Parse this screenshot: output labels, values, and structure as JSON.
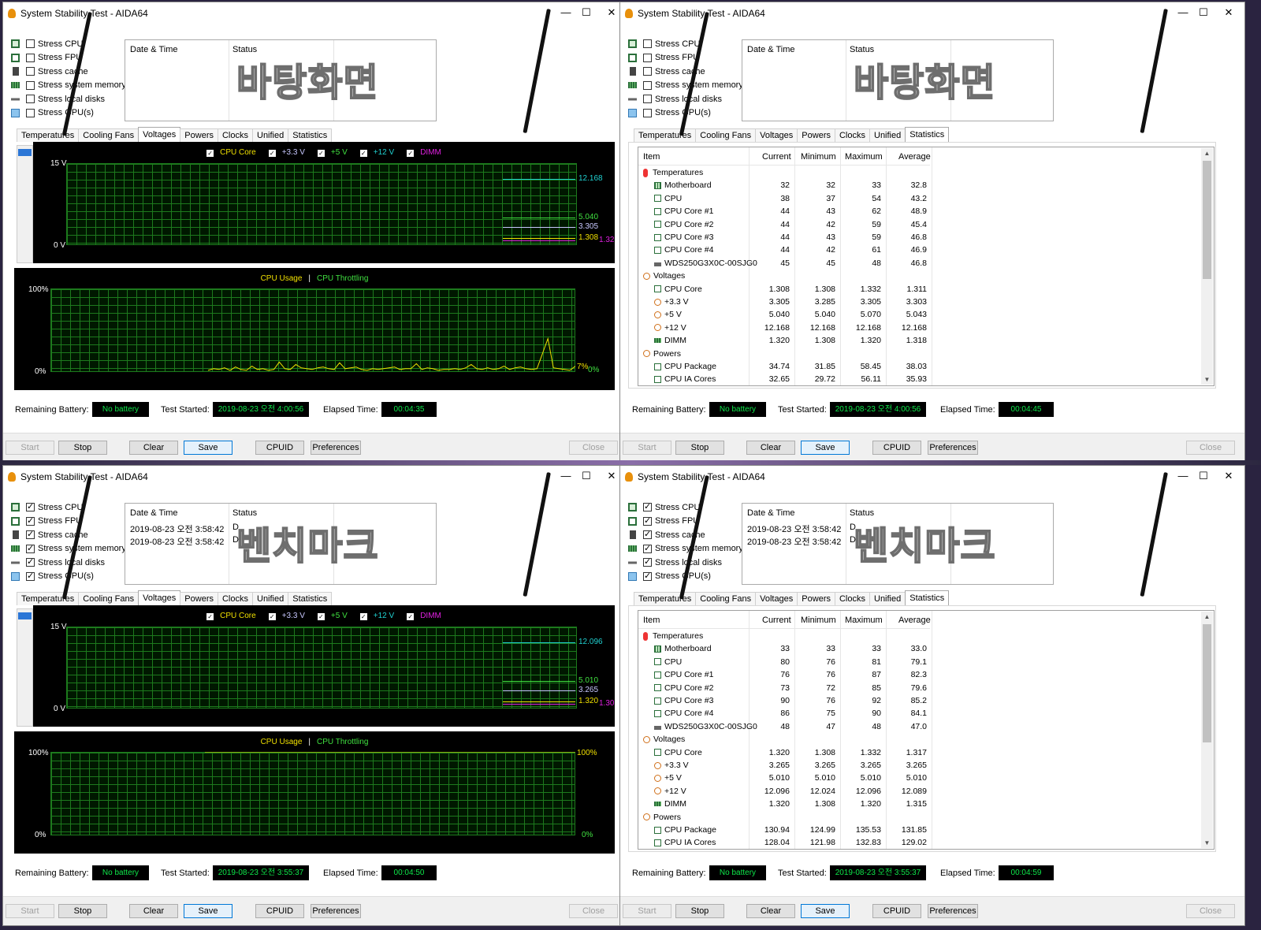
{
  "window_title": "System Stability Test - AIDA64",
  "stress_items": [
    "Stress CPU",
    "Stress FPU",
    "Stress cache",
    "Stress system memory",
    "Stress local disks",
    "Stress GPU(s)"
  ],
  "status_headers": {
    "date_time": "Date & Time",
    "status": "Status"
  },
  "tabs": [
    "Temperatures",
    "Cooling Fans",
    "Voltages",
    "Powers",
    "Clocks",
    "Unified",
    "Statistics"
  ],
  "buttons": {
    "start": "Start",
    "stop": "Stop",
    "clear": "Clear",
    "save": "Save",
    "cpuid": "CPUID",
    "preferences": "Preferences",
    "close": "Close"
  },
  "bottom_labels": {
    "battery": "Remaining Battery:",
    "started": "Test Started:",
    "elapsed": "Elapsed Time:"
  },
  "volt_legend": [
    {
      "label": "CPU Core",
      "color": "#f0e000"
    },
    {
      "label": "+3.3 V",
      "color": "#c8c8ff"
    },
    {
      "label": "+5 V",
      "color": "#40e040"
    },
    {
      "label": "+12 V",
      "color": "#20d0d0"
    },
    {
      "label": "DIMM",
      "color": "#e020e0"
    }
  ],
  "volt_axis": {
    "top": "15 V",
    "bottom": "0 V"
  },
  "cpu_legend": {
    "usage": "CPU Usage",
    "sep": "|",
    "throttling": "CPU Throttling"
  },
  "cpu_axis": {
    "top": "100%",
    "bottom": "0%"
  },
  "stats_headers": {
    "item": "Item",
    "current": "Current",
    "minimum": "Minimum",
    "maximum": "Maximum",
    "average": "Average"
  },
  "windows": {
    "tl": {
      "overlay": "바탕화면",
      "checked": [
        false,
        false,
        false,
        false,
        false,
        false
      ],
      "active_tab": 2,
      "log": [],
      "volt_values": {
        "v12": "12.168",
        "v5": "5.040",
        "v33": "3.305",
        "core": "1.308",
        "dimm": "1.32"
      },
      "cpu_values": {
        "usage": "7%",
        "throttle": "0%"
      },
      "battery": "No battery",
      "started": "2019-08-23 오전 4:00:56",
      "elapsed": "00:04:35"
    },
    "tr": {
      "overlay": "바탕화면",
      "checked": [
        false,
        false,
        false,
        false,
        false,
        false
      ],
      "active_tab": 6,
      "log": [],
      "battery": "No battery",
      "started": "2019-08-23 오전 4:00:56",
      "elapsed": "00:04:45",
      "stats": [
        {
          "type": "group",
          "icon": "therm",
          "name": "Temperatures"
        },
        {
          "type": "row",
          "icon": "board",
          "name": "Motherboard",
          "cur": "32",
          "min": "32",
          "max": "33",
          "avg": "32.8"
        },
        {
          "type": "row",
          "icon": "box",
          "name": "CPU",
          "cur": "38",
          "min": "37",
          "max": "54",
          "avg": "43.2"
        },
        {
          "type": "row",
          "icon": "box",
          "name": "CPU Core #1",
          "cur": "44",
          "min": "43",
          "max": "62",
          "avg": "48.9"
        },
        {
          "type": "row",
          "icon": "box",
          "name": "CPU Core #2",
          "cur": "44",
          "min": "42",
          "max": "59",
          "avg": "45.4"
        },
        {
          "type": "row",
          "icon": "box",
          "name": "CPU Core #3",
          "cur": "44",
          "min": "43",
          "max": "59",
          "avg": "46.8"
        },
        {
          "type": "row",
          "icon": "box",
          "name": "CPU Core #4",
          "cur": "44",
          "min": "42",
          "max": "61",
          "avg": "46.9"
        },
        {
          "type": "row",
          "icon": "disk",
          "name": "WDS250G3X0C-00SJG0",
          "cur": "45",
          "min": "45",
          "max": "48",
          "avg": "46.8"
        },
        {
          "type": "group",
          "icon": "bolt",
          "name": "Voltages"
        },
        {
          "type": "row",
          "icon": "box",
          "name": "CPU Core",
          "cur": "1.308",
          "min": "1.308",
          "max": "1.332",
          "avg": "1.311"
        },
        {
          "type": "row",
          "icon": "bolt",
          "name": "+3.3 V",
          "cur": "3.305",
          "min": "3.285",
          "max": "3.305",
          "avg": "3.303"
        },
        {
          "type": "row",
          "icon": "bolt",
          "name": "+5 V",
          "cur": "5.040",
          "min": "5.040",
          "max": "5.070",
          "avg": "5.043"
        },
        {
          "type": "row",
          "icon": "bolt",
          "name": "+12 V",
          "cur": "12.168",
          "min": "12.168",
          "max": "12.168",
          "avg": "12.168"
        },
        {
          "type": "row",
          "icon": "mem",
          "name": "DIMM",
          "cur": "1.320",
          "min": "1.308",
          "max": "1.320",
          "avg": "1.318"
        },
        {
          "type": "group",
          "icon": "bolt",
          "name": "Powers"
        },
        {
          "type": "row",
          "icon": "box",
          "name": "CPU Package",
          "cur": "34.74",
          "min": "31.85",
          "max": "58.45",
          "avg": "38.03"
        },
        {
          "type": "row",
          "icon": "box",
          "name": "CPU IA Cores",
          "cur": "32.65",
          "min": "29.72",
          "max": "56.11",
          "avg": "35.93"
        }
      ]
    },
    "bl": {
      "overlay": "벤치마크",
      "checked": [
        true,
        true,
        true,
        true,
        true,
        true
      ],
      "active_tab": 2,
      "log": [
        {
          "dt": "2019-08-23 오전 3:58:42",
          "st": "D"
        },
        {
          "dt": "2019-08-23 오전 3:58:42",
          "st": "D"
        }
      ],
      "volt_values": {
        "v12": "12.096",
        "v5": "5.010",
        "v33": "3.265",
        "core": "1.320",
        "dimm": "1.30"
      },
      "cpu_values": {
        "usage": "100%",
        "throttle": "0%"
      },
      "battery": "No battery",
      "started": "2019-08-23 오전 3:55:37",
      "elapsed": "00:04:50"
    },
    "br": {
      "overlay": "벤치마크",
      "checked": [
        true,
        true,
        true,
        true,
        true,
        true
      ],
      "active_tab": 6,
      "log": [
        {
          "dt": "2019-08-23 오전 3:58:42",
          "st": "D"
        },
        {
          "dt": "2019-08-23 오전 3:58:42",
          "st": "D"
        }
      ],
      "battery": "No battery",
      "started": "2019-08-23 오전 3:55:37",
      "elapsed": "00:04:59",
      "stats": [
        {
          "type": "group",
          "icon": "therm",
          "name": "Temperatures"
        },
        {
          "type": "row",
          "icon": "board",
          "name": "Motherboard",
          "cur": "33",
          "min": "33",
          "max": "33",
          "avg": "33.0"
        },
        {
          "type": "row",
          "icon": "box",
          "name": "CPU",
          "cur": "80",
          "min": "76",
          "max": "81",
          "avg": "79.1"
        },
        {
          "type": "row",
          "icon": "box",
          "name": "CPU Core #1",
          "cur": "76",
          "min": "76",
          "max": "87",
          "avg": "82.3"
        },
        {
          "type": "row",
          "icon": "box",
          "name": "CPU Core #2",
          "cur": "73",
          "min": "72",
          "max": "85",
          "avg": "79.6"
        },
        {
          "type": "row",
          "icon": "box",
          "name": "CPU Core #3",
          "cur": "90",
          "min": "76",
          "max": "92",
          "avg": "85.2"
        },
        {
          "type": "row",
          "icon": "box",
          "name": "CPU Core #4",
          "cur": "86",
          "min": "75",
          "max": "90",
          "avg": "84.1"
        },
        {
          "type": "row",
          "icon": "disk",
          "name": "WDS250G3X0C-00SJG0",
          "cur": "48",
          "min": "47",
          "max": "48",
          "avg": "47.0"
        },
        {
          "type": "group",
          "icon": "bolt",
          "name": "Voltages"
        },
        {
          "type": "row",
          "icon": "box",
          "name": "CPU Core",
          "cur": "1.320",
          "min": "1.308",
          "max": "1.332",
          "avg": "1.317"
        },
        {
          "type": "row",
          "icon": "bolt",
          "name": "+3.3 V",
          "cur": "3.265",
          "min": "3.265",
          "max": "3.265",
          "avg": "3.265"
        },
        {
          "type": "row",
          "icon": "bolt",
          "name": "+5 V",
          "cur": "5.010",
          "min": "5.010",
          "max": "5.010",
          "avg": "5.010"
        },
        {
          "type": "row",
          "icon": "bolt",
          "name": "+12 V",
          "cur": "12.096",
          "min": "12.024",
          "max": "12.096",
          "avg": "12.089"
        },
        {
          "type": "row",
          "icon": "mem",
          "name": "DIMM",
          "cur": "1.320",
          "min": "1.308",
          "max": "1.320",
          "avg": "1.315"
        },
        {
          "type": "group",
          "icon": "bolt",
          "name": "Powers"
        },
        {
          "type": "row",
          "icon": "box",
          "name": "CPU Package",
          "cur": "130.94",
          "min": "124.99",
          "max": "135.53",
          "avg": "131.85"
        },
        {
          "type": "row",
          "icon": "box",
          "name": "CPU IA Cores",
          "cur": "128.04",
          "min": "121.98",
          "max": "132.83",
          "avg": "129.02"
        }
      ]
    }
  },
  "cpu_usage_trace_tl": [
    2,
    4,
    3,
    5,
    2,
    6,
    3,
    2,
    7,
    3,
    4,
    2,
    3,
    12,
    4,
    3,
    9,
    5,
    4,
    3,
    5,
    6,
    4,
    3,
    11,
    4,
    5,
    6,
    3,
    2,
    4,
    3,
    4,
    5,
    6,
    3,
    4,
    4,
    10,
    3,
    5,
    4,
    2,
    3,
    3,
    4,
    3,
    5,
    9,
    4,
    3,
    5,
    3,
    4,
    7,
    3,
    5,
    6,
    4,
    3,
    4,
    22,
    40,
    5,
    4,
    3,
    2,
    7
  ]
}
